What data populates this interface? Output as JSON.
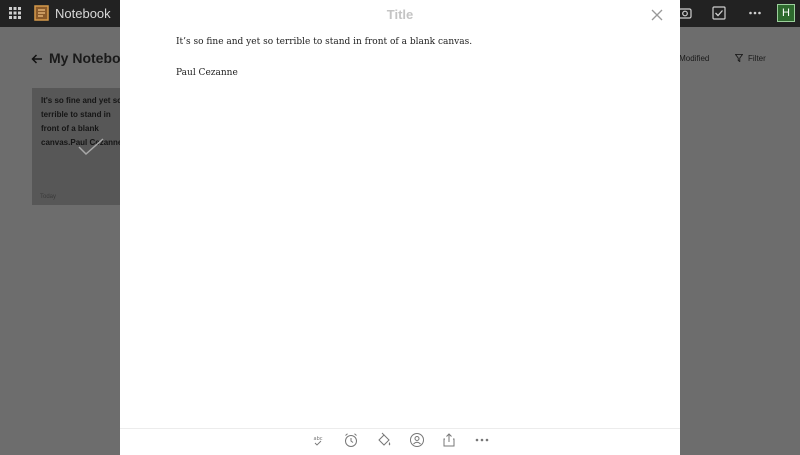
{
  "app": {
    "name": "Notebook",
    "avatar_initial": "H"
  },
  "notebook": {
    "title": "My Notebook",
    "sort_label": "Date Modified",
    "filter_label": "Filter"
  },
  "note_card": {
    "text": "It's so fine and yet so terrible to stand in front of a blank canvas.Paul Cezanne",
    "date": "Today"
  },
  "note_editor": {
    "title_placeholder": "Title",
    "body_line": "It’s so fine and yet so terrible to stand in front of a blank canvas.",
    "signature": "Paul Cezanne"
  },
  "toolbar": {
    "items": [
      "format-text-icon",
      "alarm-icon",
      "color-fill-icon",
      "share-person-icon",
      "export-icon",
      "more-icon"
    ]
  },
  "colors": {
    "modal_background": "#ffffff",
    "backdrop": "#6d6d6d",
    "topbar": "#222222",
    "avatar": "#2e6a2e"
  }
}
